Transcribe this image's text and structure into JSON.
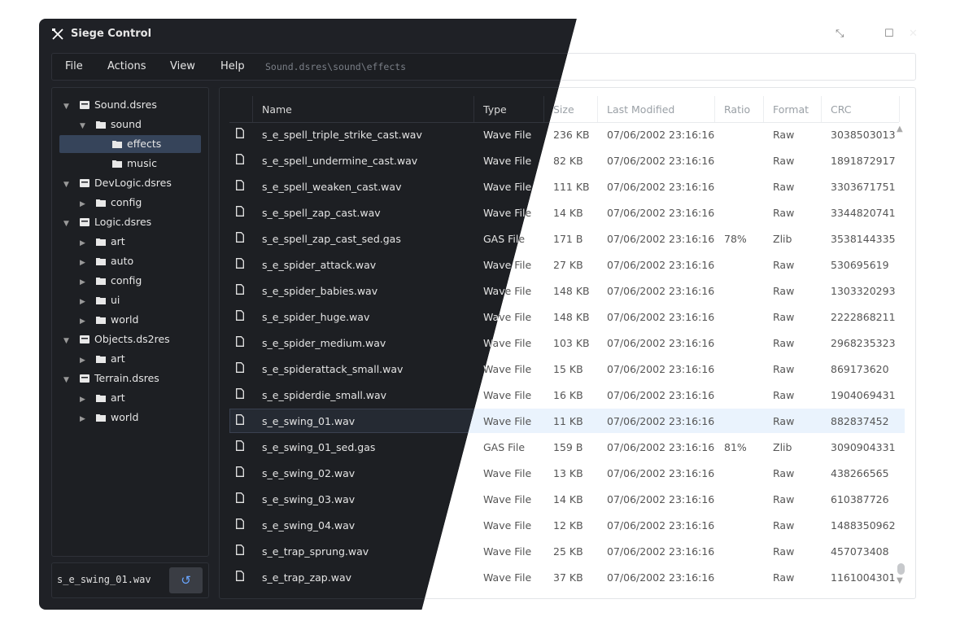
{
  "window": {
    "title": "Siege Control",
    "minimize": "⤡",
    "maximize": "☐",
    "close": "✕"
  },
  "menu": {
    "items": [
      "File",
      "Actions",
      "View",
      "Help"
    ],
    "path": "Sound.dsres\\sound\\effects"
  },
  "tree": [
    {
      "label": "Sound.dsres",
      "level": 0,
      "expanded": true,
      "kind": "archive"
    },
    {
      "label": "sound",
      "level": 1,
      "expanded": true,
      "kind": "folder"
    },
    {
      "label": "effects",
      "level": 2,
      "expanded": null,
      "kind": "folder",
      "selected": true
    },
    {
      "label": "music",
      "level": 2,
      "expanded": null,
      "kind": "folder"
    },
    {
      "label": "DevLogic.dsres",
      "level": 0,
      "expanded": true,
      "kind": "archive"
    },
    {
      "label": "config",
      "level": 1,
      "expanded": false,
      "kind": "folder"
    },
    {
      "label": "Logic.dsres",
      "level": 0,
      "expanded": true,
      "kind": "archive"
    },
    {
      "label": "art",
      "level": 1,
      "expanded": false,
      "kind": "folder"
    },
    {
      "label": "auto",
      "level": 1,
      "expanded": false,
      "kind": "folder"
    },
    {
      "label": "config",
      "level": 1,
      "expanded": false,
      "kind": "folder"
    },
    {
      "label": "ui",
      "level": 1,
      "expanded": false,
      "kind": "folder"
    },
    {
      "label": "world",
      "level": 1,
      "expanded": false,
      "kind": "folder"
    },
    {
      "label": "Objects.ds2res",
      "level": 0,
      "expanded": true,
      "kind": "archive"
    },
    {
      "label": "art",
      "level": 1,
      "expanded": false,
      "kind": "folder"
    },
    {
      "label": "Terrain.dsres",
      "level": 0,
      "expanded": true,
      "kind": "archive"
    },
    {
      "label": "art",
      "level": 1,
      "expanded": false,
      "kind": "folder"
    },
    {
      "label": "world",
      "level": 1,
      "expanded": false,
      "kind": "folder"
    }
  ],
  "name_field": {
    "value": "s_e_swing_01.wav",
    "refresh_icon": "↺"
  },
  "columns": [
    "Name",
    "Type",
    "Size",
    "Last Modified",
    "Ratio",
    "Format",
    "CRC"
  ],
  "files": [
    {
      "name": "s_e_spell_triple_strike_cast.wav",
      "type": "Wave File",
      "size": "236 KB",
      "modified": "07/06/2002 23:16:16",
      "ratio": "",
      "format": "Raw",
      "crc": "3038503013"
    },
    {
      "name": "s_e_spell_undermine_cast.wav",
      "type": "Wave File",
      "size": "82 KB",
      "modified": "07/06/2002 23:16:16",
      "ratio": "",
      "format": "Raw",
      "crc": "1891872917"
    },
    {
      "name": "s_e_spell_weaken_cast.wav",
      "type": "Wave File",
      "size": "111 KB",
      "modified": "07/06/2002 23:16:16",
      "ratio": "",
      "format": "Raw",
      "crc": "3303671751"
    },
    {
      "name": "s_e_spell_zap_cast.wav",
      "type": "Wave File",
      "size": "14 KB",
      "modified": "07/06/2002 23:16:16",
      "ratio": "",
      "format": "Raw",
      "crc": "3344820741"
    },
    {
      "name": "s_e_spell_zap_cast_sed.gas",
      "type": "GAS File",
      "size": "171 B",
      "modified": "07/06/2002 23:16:16",
      "ratio": "78%",
      "format": "Zlib",
      "crc": "3538144335"
    },
    {
      "name": "s_e_spider_attack.wav",
      "type": "Wave File",
      "size": "27 KB",
      "modified": "07/06/2002 23:16:16",
      "ratio": "",
      "format": "Raw",
      "crc": "530695619"
    },
    {
      "name": "s_e_spider_babies.wav",
      "type": "Wave File",
      "size": "148 KB",
      "modified": "07/06/2002 23:16:16",
      "ratio": "",
      "format": "Raw",
      "crc": "1303320293"
    },
    {
      "name": "s_e_spider_huge.wav",
      "type": "Wave File",
      "size": "148 KB",
      "modified": "07/06/2002 23:16:16",
      "ratio": "",
      "format": "Raw",
      "crc": "2222868211"
    },
    {
      "name": "s_e_spider_medium.wav",
      "type": "Wave File",
      "size": "103 KB",
      "modified": "07/06/2002 23:16:16",
      "ratio": "",
      "format": "Raw",
      "crc": "2968235323"
    },
    {
      "name": "s_e_spiderattack_small.wav",
      "type": "Wave File",
      "size": "15 KB",
      "modified": "07/06/2002 23:16:16",
      "ratio": "",
      "format": "Raw",
      "crc": "869173620"
    },
    {
      "name": "s_e_spiderdie_small.wav",
      "type": "Wave File",
      "size": "16 KB",
      "modified": "07/06/2002 23:16:16",
      "ratio": "",
      "format": "Raw",
      "crc": "1904069431"
    },
    {
      "name": "s_e_swing_01.wav",
      "type": "Wave File",
      "size": "11 KB",
      "modified": "07/06/2002 23:16:16",
      "ratio": "",
      "format": "Raw",
      "crc": "882837452",
      "selected": true
    },
    {
      "name": "s_e_swing_01_sed.gas",
      "type": "GAS File",
      "size": "159 B",
      "modified": "07/06/2002 23:16:16",
      "ratio": "81%",
      "format": "Zlib",
      "crc": "3090904331"
    },
    {
      "name": "s_e_swing_02.wav",
      "type": "Wave File",
      "size": "13 KB",
      "modified": "07/06/2002 23:16:16",
      "ratio": "",
      "format": "Raw",
      "crc": "438266565"
    },
    {
      "name": "s_e_swing_03.wav",
      "type": "Wave File",
      "size": "14 KB",
      "modified": "07/06/2002 23:16:16",
      "ratio": "",
      "format": "Raw",
      "crc": "610387726"
    },
    {
      "name": "s_e_swing_04.wav",
      "type": "Wave File",
      "size": "12 KB",
      "modified": "07/06/2002 23:16:16",
      "ratio": "",
      "format": "Raw",
      "crc": "1488350962"
    },
    {
      "name": "s_e_trap_sprung.wav",
      "type": "Wave File",
      "size": "25 KB",
      "modified": "07/06/2002 23:16:16",
      "ratio": "",
      "format": "Raw",
      "crc": "457073408"
    },
    {
      "name": "s_e_trap_zap.wav",
      "type": "Wave File",
      "size": "37 KB",
      "modified": "07/06/2002 23:16:16",
      "ratio": "",
      "format": "Raw",
      "crc": "1161004301"
    }
  ],
  "colors": {
    "dark_bg": "#1f2126",
    "selection_dark": "#36445a",
    "selection_light": "#eaf3fd",
    "accent": "#6aa6ff"
  }
}
